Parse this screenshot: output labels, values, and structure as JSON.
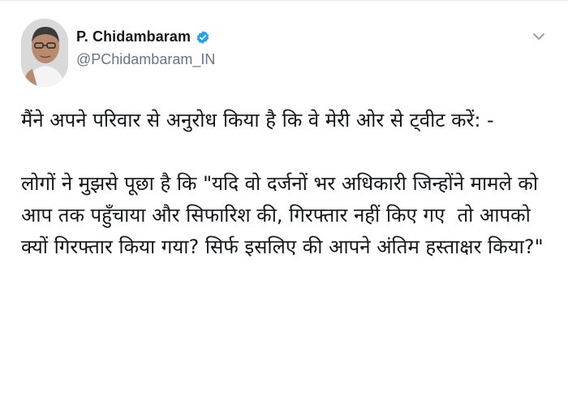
{
  "author": {
    "display_name": "P. Chidambaram",
    "handle": "@PChidambaram_IN",
    "verified": true,
    "verified_color": "#1da1f2"
  },
  "icons": {
    "verified": "verified-badge-icon",
    "menu": "chevron-down-icon"
  },
  "tweet": {
    "paragraphs": [
      "मैंने अपने परिवार से अनुरोध किया है कि वे मेरी ओर से ट्वीट करें: -",
      "लोगों ने मुझसे पूछा है कि \"यदि वो दर्जनों भर अधिकारी जिन्होंने मामले को आप तक पहुँचाया और सिफारिश की, गिरफ्तार नहीं किए गए  तो आपको क्यों गिरफ्तार किया गया? सिर्फ इसलिए की आपने अंतिम हस्ताक्षर किया?\""
    ]
  }
}
